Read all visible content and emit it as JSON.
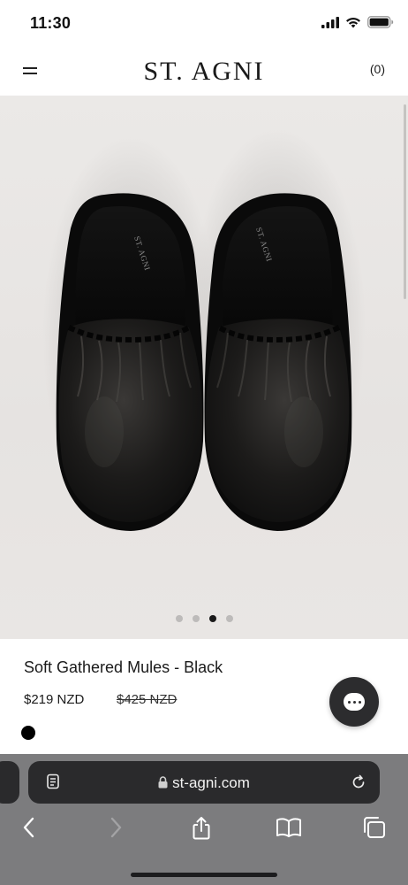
{
  "status_bar": {
    "time": "11:30",
    "icons": [
      "cellular-signal-icon",
      "wifi-icon",
      "battery-icon"
    ]
  },
  "header": {
    "menu_icon": "hamburger-menu-icon",
    "brand": "ST. AGNI",
    "cart_count": "(0)"
  },
  "gallery": {
    "image_subject": "black leather gathered mules, top view",
    "insole_print": "ST. AGNI",
    "slide_count": 4,
    "active_slide": 3
  },
  "product": {
    "title": "Soft Gathered Mules - Black",
    "price": "$219 NZD",
    "compare_at_price": "$425 NZD",
    "swatch_color": "#000000"
  },
  "chat": {
    "icon": "chat-bubble-icon",
    "background": "#2c2c2e"
  },
  "browser": {
    "url": "st-agni.com",
    "address_icons": [
      "reader-mode-icon",
      "lock-icon",
      "reload-icon"
    ],
    "toolbar_icons": [
      "back-icon",
      "forward-icon",
      "share-icon",
      "bookmarks-icon",
      "tabs-icon"
    ]
  },
  "colors": {
    "text": "#1a1a1a",
    "chrome_bg": "#7c7c7e",
    "address_bg": "#2a2a2c",
    "photo_bg": "#e8e5e3"
  }
}
